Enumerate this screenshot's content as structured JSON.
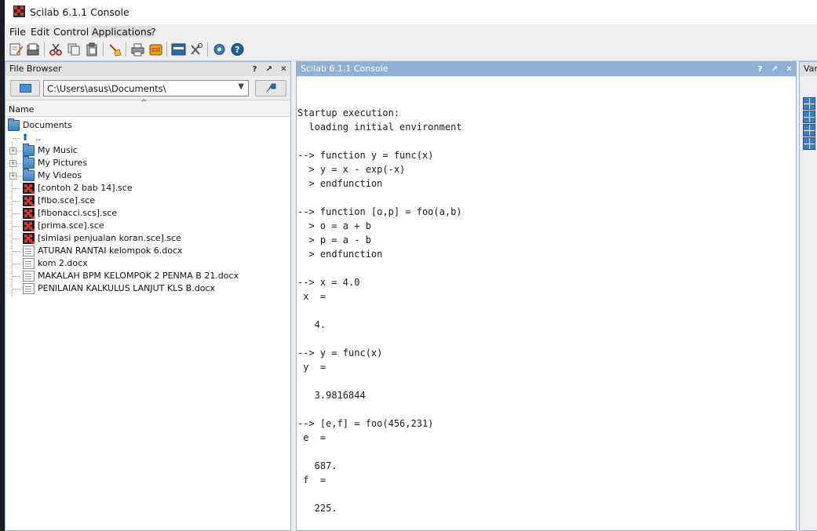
{
  "window": {
    "title": "Scilab 6.1.1 Console"
  },
  "menu": [
    {
      "label": "File"
    },
    {
      "label": "Edit"
    },
    {
      "label": "Control"
    },
    {
      "label": "Applications"
    },
    {
      "label": "?"
    }
  ],
  "toolbar": {
    "buttons": [
      "new-script-icon",
      "open-file-icon",
      "cut-icon",
      "copy-icon",
      "paste-icon",
      "clear-console-icon",
      "print-icon",
      "change-directory-icon",
      "variable-browser-icon",
      "module-manager-icon",
      "configure-icon",
      "help-icon"
    ]
  },
  "file_browser": {
    "title": "File Browser",
    "controls": [
      "?",
      "↗",
      "✕"
    ],
    "path": "C:\\Users\\asus\\Documents\\",
    "column": "Name",
    "root": "Documents",
    "items": [
      {
        "label": "..",
        "type": "up"
      },
      {
        "label": "My Music",
        "type": "folder",
        "expandable": true
      },
      {
        "label": "My Pictures",
        "type": "folder",
        "expandable": true
      },
      {
        "label": "My Videos",
        "type": "folder",
        "expandable": true
      },
      {
        "label": "[contoh 2 bab 14].sce",
        "type": "sce"
      },
      {
        "label": "[fibo.sce].sce",
        "type": "sce"
      },
      {
        "label": "[fibonacci.scs].sce",
        "type": "sce"
      },
      {
        "label": "[prima.sce].sce",
        "type": "sce"
      },
      {
        "label": "[simlasi penjualan koran.sce].sce",
        "type": "sce"
      },
      {
        "label": "ATURAN RANTAI kelompok 6.docx",
        "type": "doc"
      },
      {
        "label": "kom 2.docx",
        "type": "doc"
      },
      {
        "label": "MAKALAH BPM KELOMPOK 2 PENMA B 21.docx",
        "type": "doc"
      },
      {
        "label": "PENILAIAN KALKULUS LANJUT KLS B.docx",
        "type": "doc"
      }
    ]
  },
  "console": {
    "title": "Scilab 6.1.1 Console",
    "controls": [
      "?",
      "↗",
      "✕"
    ],
    "lines": [
      "Startup execution:",
      "  loading initial environment",
      "",
      "--> function y = func(x)",
      "  > y = x - exp(-x)",
      "  > endfunction",
      "",
      "--> function [o,p] = foo(a,b)",
      "  > o = a + b",
      "  > p = a - b",
      "  > endfunction",
      "",
      "--> x = 4.0",
      " x  =",
      "",
      "   4.",
      "",
      "--> y = func(x)",
      " y  =",
      "",
      "   3.9816844",
      "",
      "--> [e,f] = foo(456,231)",
      " e  =",
      "",
      "   687.",
      " f  =",
      "",
      "   225."
    ]
  },
  "variable_browser": {
    "title": "Var"
  }
}
